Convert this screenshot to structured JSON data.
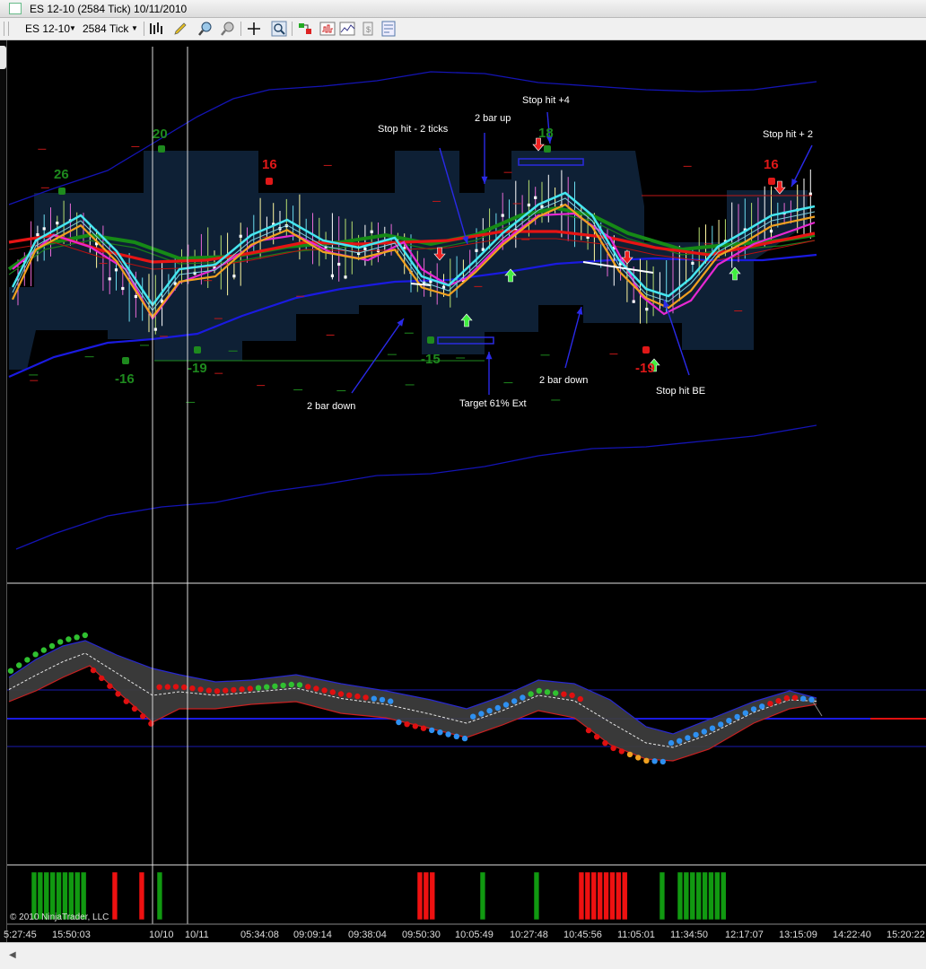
{
  "window": {
    "title": "ES 12-10 (2584 Tick)  10/11/2010"
  },
  "toolbar": {
    "instrument": "ES 12-10",
    "interval": "2584 Tick",
    "icons": [
      "bar-type-icon",
      "pencil-draw-icon",
      "zoom-in-icon",
      "zoom-out-icon",
      "crosshair-icon",
      "magnifier-icon",
      "strategy-icon",
      "chart-properties-icon",
      "data-box-icon",
      "template-icon"
    ]
  },
  "annotations": [
    {
      "id": "stop-hit-2-ticks",
      "text": "Stop hit - 2 ticks"
    },
    {
      "id": "two-bar-up",
      "text": "2 bar up"
    },
    {
      "id": "stop-hit-plus-4",
      "text": "Stop hit +4"
    },
    {
      "id": "stop-hit-plus-2",
      "text": "Stop hit + 2"
    },
    {
      "id": "two-bar-down-left",
      "text": "2 bar down"
    },
    {
      "id": "target-61-ext",
      "text": "Target 61% Ext"
    },
    {
      "id": "two-bar-down-mid",
      "text": "2 bar down"
    },
    {
      "id": "stop-hit-be",
      "text": "Stop hit BE"
    }
  ],
  "swing_labels": [
    {
      "text": "26",
      "color": "#1e8a1e"
    },
    {
      "text": "20",
      "color": "#1e8a1e"
    },
    {
      "text": "16",
      "color": "#e01818"
    },
    {
      "text": "18",
      "color": "#1e8a1e"
    },
    {
      "text": "16",
      "color": "#e01818"
    },
    {
      "text": "-16",
      "color": "#1e8a1e"
    },
    {
      "text": "-19",
      "color": "#1e8a1e"
    },
    {
      "text": "-15",
      "color": "#1e8a1e"
    },
    {
      "text": "-19",
      "color": "#e01818"
    }
  ],
  "time_axis": [
    "5:27:45",
    "15:50:03",
    "10/10",
    "10/11",
    "05:34:08",
    "09:09:14",
    "09:38:04",
    "09:50:30",
    "10:05:49",
    "10:27:48",
    "10:45:56",
    "11:05:01",
    "11:34:50",
    "12:17:07",
    "13:15:09",
    "14:22:40",
    "15:20:22"
  ],
  "copyright": "© 2010 NinjaTrader, LLC",
  "colors": {
    "background": "#000000",
    "zone": "#0f2238",
    "envelope": "#1414b4",
    "ma_red": "#e61414",
    "ma_green": "#168a16",
    "ma_cyan": "#46e6f0",
    "ma_orange": "#f0a020",
    "ma_magenta": "#e628d2",
    "dot_green": "#30c030",
    "dot_red": "#e01010",
    "dot_blue": "#2e90f0",
    "hist_green": "#119911",
    "hist_red": "#ee1111"
  },
  "chart_data": {
    "type": "line",
    "panels": [
      "price",
      "oscillator",
      "histogram"
    ],
    "histogram": [
      {
        "color": "green",
        "bars": 9
      },
      {
        "color": "red",
        "bars": 1
      },
      {
        "color": "red",
        "bars": 1
      },
      {
        "color": "green",
        "bars": 1
      },
      {
        "color": "red",
        "bars": 3
      },
      {
        "color": "green",
        "bars": 1
      },
      {
        "color": "green",
        "bars": 1
      },
      {
        "color": "red",
        "bars": 8
      },
      {
        "color": "green",
        "bars": 1
      },
      {
        "color": "green",
        "bars": 8
      }
    ]
  }
}
